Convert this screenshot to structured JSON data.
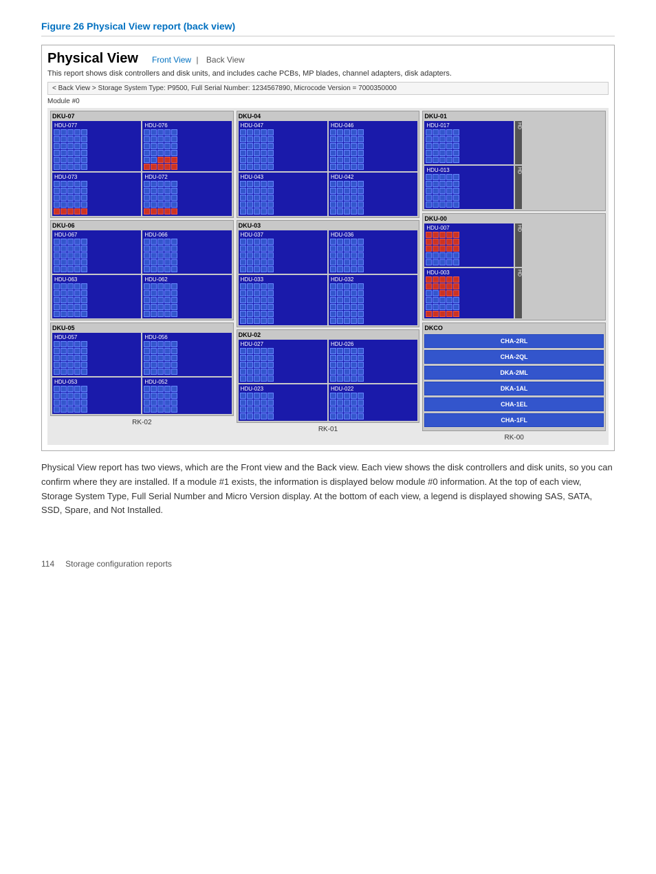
{
  "figure": {
    "title": "Figure 26 Physical View report (back view)",
    "pv_title": "Physical View",
    "nav_front": "Front View",
    "nav_separator": "|",
    "nav_back": "Back View",
    "description": "This report shows disk controllers and disk units, and includes cache PCBs, MP blades, channel adapters, disk adapters.",
    "info_bar": "< Back View > Storage System Type: P9500, Full Serial Number: 1234567890, Microcode Version = 7000350000",
    "module_label": "Module #0"
  },
  "racks": [
    {
      "label": "RK-02"
    },
    {
      "label": "RK-01"
    },
    {
      "label": "RK-00"
    }
  ],
  "dkco_items": [
    "CHA-2RL",
    "CHA-2QL",
    "DKA-2ML",
    "DKA-1AL",
    "CHA-1EL",
    "CHA-1FL"
  ],
  "description_text": "Physical View report has two views, which are the Front view and the Back view. Each view shows the disk controllers and disk units, so you can confirm where they are installed. If a module #1 exists, the information is displayed below module #0 information. At the top of each view, Storage System Type, Full Serial Number and Micro Version display. At the bottom of each view, a legend is displayed showing SAS, SATA, SSD, Spare, and Not Installed.",
  "footer": {
    "page_number": "114",
    "section": "Storage configuration reports"
  }
}
